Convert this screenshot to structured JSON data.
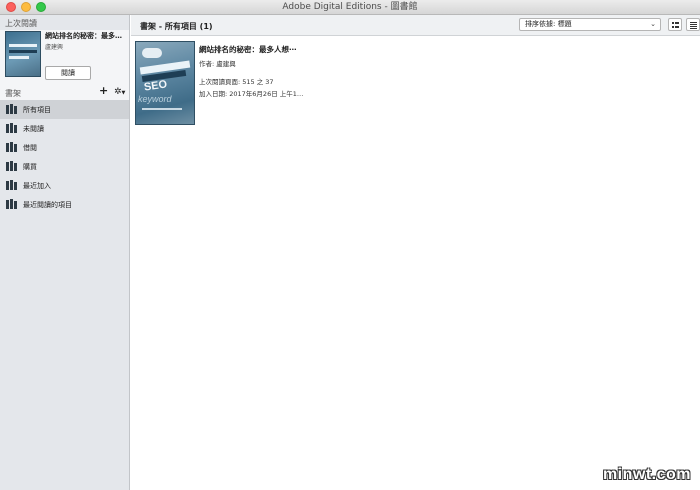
{
  "window": {
    "title": "Adobe Digital Editions - 圖書館"
  },
  "sidebar": {
    "last_read_header": "上次閱讀",
    "last_read": {
      "title": "網站排名的秘密：最多…",
      "author": "盧建興",
      "read_button": "閱讀"
    },
    "shelves_header": "書架",
    "add_icon": "plus-icon",
    "gear_icon": "gear-icon",
    "items": [
      {
        "label": "所有項目",
        "selected": true
      },
      {
        "label": "未閱讀",
        "selected": false
      },
      {
        "label": "借閱",
        "selected": false
      },
      {
        "label": "購買",
        "selected": false
      },
      {
        "label": "最近加入",
        "selected": false
      },
      {
        "label": "最近閱讀的項目",
        "selected": false
      }
    ]
  },
  "toolbar": {
    "shelf_title": "書架 - 所有項目 (1)",
    "sort_label": "排序依據: 標題",
    "grid_view_icon": "grid-view-icon",
    "list_view_icon": "list-view-icon"
  },
  "book": {
    "title": "網站排名的秘密：最多人想⋯",
    "author": "作者: 盧建興",
    "last_page": "上次閱讀頁面: 515 之 37",
    "added": "加入日期: 2017年6月26日 上午1…"
  },
  "watermark": "minwt.com"
}
